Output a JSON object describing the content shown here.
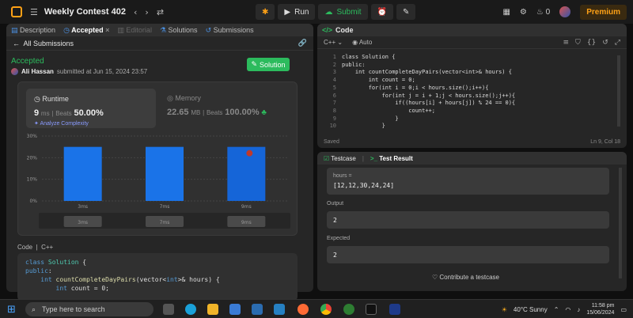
{
  "topbar": {
    "title": "Weekly Contest 402",
    "run_label": "Run",
    "submit_label": "Submit",
    "streak": "0",
    "premium_label": "Premium"
  },
  "left": {
    "tabs": [
      {
        "label": "Description"
      },
      {
        "label": "Accepted"
      },
      {
        "label": "Editorial"
      },
      {
        "label": "Solutions"
      },
      {
        "label": "Submissions"
      }
    ],
    "back_label": "All Submissions",
    "status": "Accepted",
    "author": "Ali Hassan",
    "submitted_text": "submitted at Jun 15, 2024 23:57",
    "solution_btn": "Solution",
    "runtime": {
      "title": "Runtime",
      "value": "9",
      "unit": "ms",
      "beats_label": "Beats",
      "beats": "50.00%",
      "analyze": "Analyze Complexity"
    },
    "memory": {
      "title": "Memory",
      "value": "22.65",
      "unit": "MB",
      "beats_label": "Beats",
      "beats": "100.00%"
    },
    "code_label": "Code",
    "code_lang": "C++",
    "code_lines": [
      "class Solution {",
      "public:",
      "    int countCompleteDayPairs(vector<int>& hours) {",
      "        int count = 0;"
    ]
  },
  "chart_data": {
    "type": "bar",
    "categories": [
      "3ms",
      "7ms",
      "9ms"
    ],
    "values": [
      25,
      25,
      25
    ],
    "ylim": [
      0,
      30
    ],
    "yticks": [
      "0%",
      "10%",
      "20%",
      "30%"
    ],
    "minimap_labels": [
      "3ms",
      "7ms",
      "9ms"
    ],
    "highlight_index": 2,
    "bar_color": "#1a73e8"
  },
  "code_panel": {
    "title": "Code",
    "lang": "C++",
    "mode": "Auto",
    "lines": [
      "class Solution {",
      "public:",
      "    int countCompleteDayPairs(vector<int>& hours) {",
      "        int count = 0;",
      "        for(int i = 0;i < hours.size();i++){",
      "            for(int j = i + 1;j < hours.size();j++){",
      "                if((hours[i] + hours[j]) % 24 == 0){",
      "                    count++;",
      "                }",
      "            }"
    ],
    "saved": "Saved",
    "cursor": "Ln 9, Col 18"
  },
  "test_panel": {
    "tab1": "Testcase",
    "tab2": "Test Result",
    "input_label": "hours =",
    "input_value": "[12,12,30,24,24]",
    "output_label": "Output",
    "output_value": "2",
    "expected_label": "Expected",
    "expected_value": "2",
    "contribute": "Contribute a testcase"
  },
  "taskbar": {
    "search_placeholder": "Type here to search",
    "weather": "40°C  Sunny",
    "time": "11:58 pm",
    "date": "15/06/2024"
  }
}
